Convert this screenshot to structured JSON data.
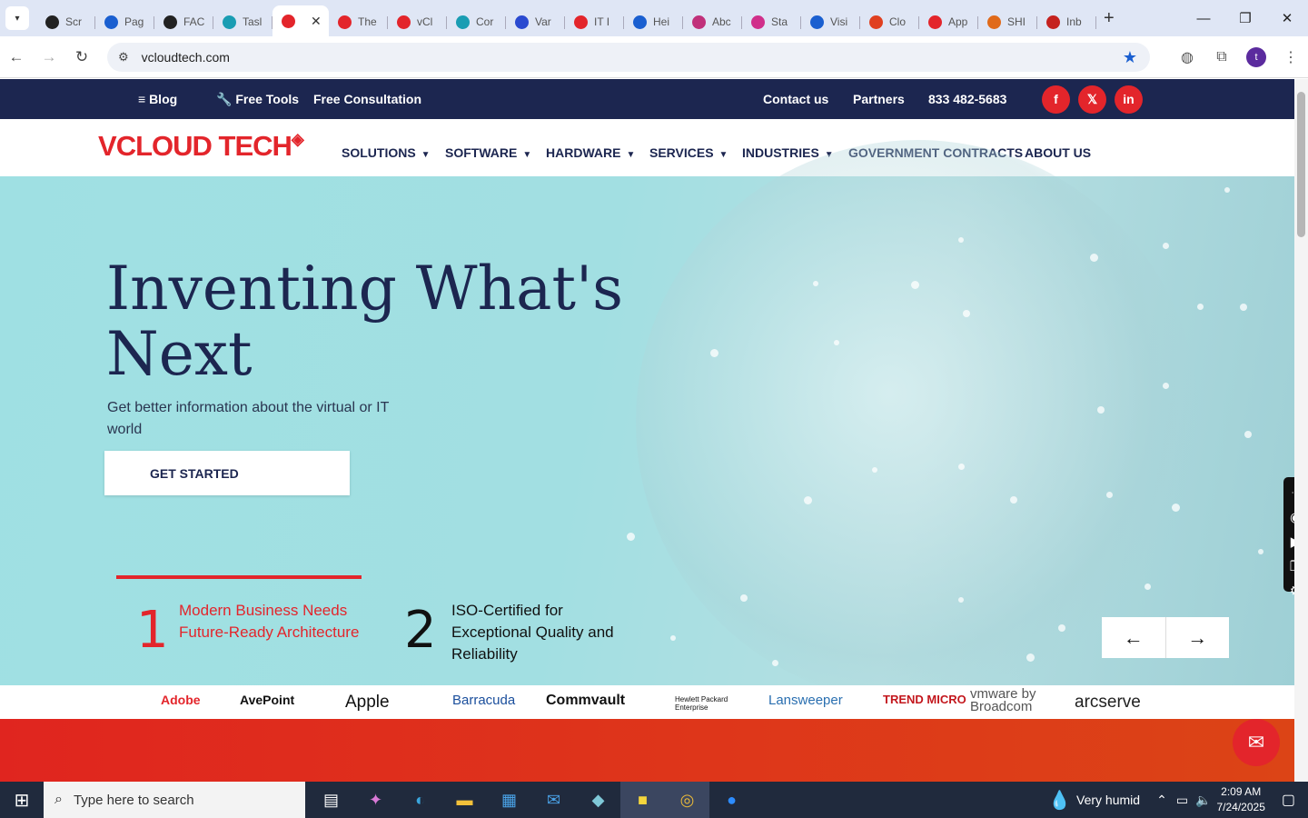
{
  "browser": {
    "tabs": [
      {
        "title": "Scr",
        "color": "#222"
      },
      {
        "title": "Pag",
        "color": "#1a5fd0"
      },
      {
        "title": "FAC",
        "color": "#222"
      },
      {
        "title": "Tasl",
        "color": "#1a9db3"
      },
      {
        "title": "",
        "color": "#e3252b",
        "active": true
      },
      {
        "title": "The",
        "color": "#e3252b"
      },
      {
        "title": "vCl",
        "color": "#e3252b"
      },
      {
        "title": "Cor",
        "color": "#1a9db3"
      },
      {
        "title": "Var",
        "color": "#2a4ad0"
      },
      {
        "title": "IT I",
        "color": "#e3252b"
      },
      {
        "title": "Hei",
        "color": "#1a5fd0"
      },
      {
        "title": "Abc",
        "color": "#c0307a"
      },
      {
        "title": "Sta",
        "color": "#d02f8a"
      },
      {
        "title": "Visi",
        "color": "#1a5fd0"
      },
      {
        "title": "Clo",
        "color": "#e04020"
      },
      {
        "title": "App",
        "color": "#e3252b"
      },
      {
        "title": "SHI",
        "color": "#e06a1a"
      },
      {
        "title": "Inb",
        "color": "#c5221f"
      }
    ],
    "url": "vcloudtech.com",
    "profile_initial": "t"
  },
  "topbar": {
    "blog": "Blog",
    "free_tools": "Free Tools",
    "free_consultation": "Free Consultation",
    "contact": "Contact us",
    "partners": "Partners",
    "phone": "833 482-5683",
    "social": [
      "f",
      "𝕏",
      "in"
    ]
  },
  "logo": {
    "part1": "V",
    "part2": "CLOUD TECH"
  },
  "nav": [
    "SOLUTIONS",
    "SOFTWARE",
    "HARDWARE",
    "SERVICES",
    "INDUSTRIES",
    "GOVERNMENT CONTRACTS",
    "ABOUT US"
  ],
  "hero": {
    "title": "Inventing What's Next",
    "subtitle": "Get better information about the virtual or IT world",
    "cta": "GET STARTED",
    "features": [
      {
        "num": "1",
        "text": "Modern Business Needs Future-Ready Architecture",
        "color": "#e3252b"
      },
      {
        "num": "2",
        "text": "ISO-Certified for Exceptional Quality and Reliability",
        "color": "#111"
      }
    ],
    "prev": "←",
    "next": "→"
  },
  "brands": [
    "Adobe",
    "AvePoint",
    "Apple",
    "Barracuda",
    "Commvault",
    "Hewlett Packard Enterprise",
    "Lansweeper",
    "TREND MICRO",
    "vmware by Broadcom",
    "arcserve"
  ],
  "colors": {
    "navy": "#1c2650",
    "red": "#e3252b",
    "hero": "#a2dfe2"
  },
  "taskbar": {
    "search_placeholder": "Type here to search",
    "weather": "Very humid",
    "time": "2:09 AM",
    "date": "7/24/2025"
  }
}
